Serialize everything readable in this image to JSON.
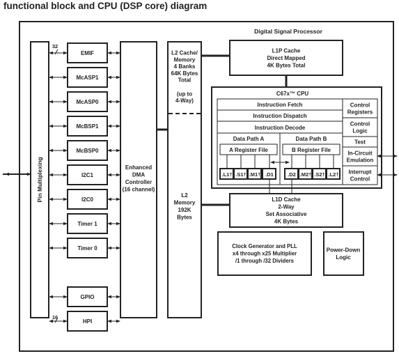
{
  "title": "functional block and CPU (DSP core) diagram",
  "dsp_label": "Digital Signal Processor",
  "pin_mux": "Pin Multiplexing",
  "bus_widths": {
    "emif": "32",
    "hpi": "16"
  },
  "peripherals": [
    "EMIF",
    "McASP1",
    "McASP0",
    "McBSP1",
    "McBSP0",
    "I2C1",
    "I2C0",
    "Timer 1",
    "Timer 0",
    "GPIO",
    "HPI"
  ],
  "dma": [
    "Enhanced",
    "DMA",
    "Controller",
    "(16 channel)"
  ],
  "l2_cache": [
    "L2 Cache/",
    "Memory",
    "4 Banks",
    "64K Bytes",
    "Total",
    "",
    "(up to",
    "4-Way)"
  ],
  "l2_memory": [
    "L2",
    "Memory",
    "192K",
    "Bytes"
  ],
  "l1p": [
    "L1P Cache",
    "Direct Mapped",
    "4K Bytes Total"
  ],
  "cpu": {
    "title": "C67x™ CPU",
    "fetch": "Instruction Fetch",
    "dispatch": "Instruction Dispatch",
    "decode": "Instruction Decode",
    "path_a": "Data Path A",
    "path_b": "Data Path B",
    "reg_a": "A Register File",
    "reg_b": "B Register File",
    "units_a": [
      ".L1†",
      ".S1†",
      ".M1†",
      ".D1"
    ],
    "units_b": [
      ".D2",
      ".M2†",
      ".S2†",
      ".L2†"
    ],
    "side": [
      [
        "Control",
        "Registers"
      ],
      [
        "Control",
        "Logic"
      ],
      [
        "Test"
      ],
      [
        "In-Circuit",
        "Emulation"
      ],
      [
        "Interrupt",
        "Control"
      ]
    ]
  },
  "l1d": [
    "L1D Cache",
    "2-Way",
    "Set Associative",
    "4K Bytes"
  ],
  "clock": [
    "Clock Generator and PLL",
    "x4 through x25 Multiplier",
    "/1 through /32 Dividers"
  ],
  "power_down": [
    "Power-Down",
    "Logic"
  ]
}
